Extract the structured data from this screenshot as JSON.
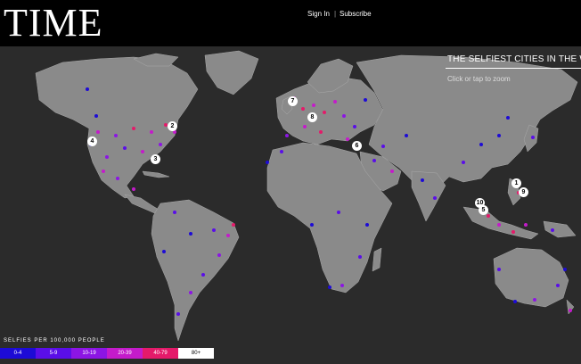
{
  "header": {
    "logo": "TIME",
    "sign_in": "Sign In",
    "separator": "|",
    "subscribe": "Subscribe"
  },
  "story": {
    "title": "THE SELFIEST CITIES IN THE WO",
    "hint": "Click or tap to zoom"
  },
  "legend": {
    "title": "SELFIES PER 100,000 PEOPLE",
    "items": [
      {
        "label": "0-4",
        "color": "#1d0bd6"
      },
      {
        "label": "5-9",
        "color": "#5a0ee8"
      },
      {
        "label": "10-19",
        "color": "#8c15e4"
      },
      {
        "label": "20-39",
        "color": "#c41bcb"
      },
      {
        "label": "40-79",
        "color": "#e41a6a"
      },
      {
        "label": "80+",
        "color": "#ffffff"
      }
    ]
  },
  "rank_markers": [
    "1",
    "2",
    "3",
    "4",
    "5",
    "6",
    "7",
    "8",
    "9",
    "10"
  ],
  "colors": {
    "land": "#8a8a8a",
    "ocean": "#2b2b2b",
    "header": "#000000"
  }
}
